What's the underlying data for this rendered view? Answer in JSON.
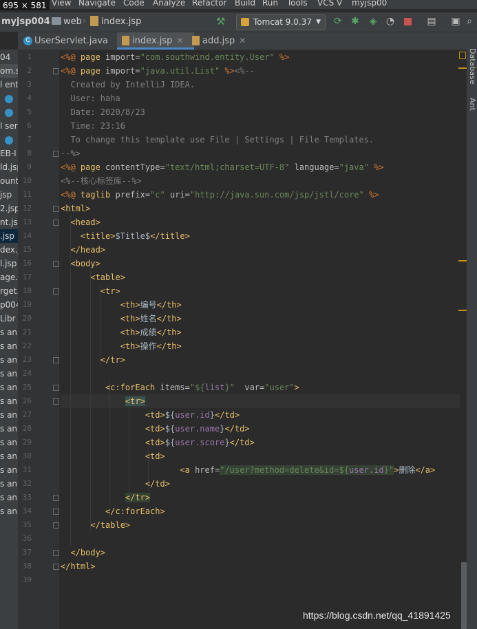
{
  "dimensions_badge": "695 × 581",
  "menu": [
    "t",
    "View",
    "Navigate",
    "Code",
    "Analyze",
    "Refactor",
    "Build",
    "Run",
    "Tools",
    "VCS",
    "V",
    "myjsp00"
  ],
  "breadcrumb": {
    "project": "myjsp004",
    "folder": "web",
    "file": "index.jsp"
  },
  "run_config": "Tomcat 9.0.37",
  "tabs": [
    {
      "label": "UserServlet.java",
      "type": "java"
    },
    {
      "label": "index.jsp",
      "type": "jsp",
      "active": true
    },
    {
      "label": "add.jsp",
      "type": "jsp"
    }
  ],
  "right_tools": [
    "Database",
    "Ant"
  ],
  "left_panel": [
    "04",
    "om.sc",
    "l ent",
    "",
    "",
    "l ser",
    "",
    "EB-I",
    "ld.jsp",
    "ount.j",
    "jsp",
    "2.jsp",
    "nt.jsp",
    ".jsp",
    "dex.js",
    "l.jsp",
    "age.j",
    "rget.",
    "p004",
    "Libr",
    "s an",
    "s an",
    "s an",
    "s an",
    "s an",
    "s an",
    "s an",
    "s an",
    "s an",
    "s an",
    "s an",
    "s an",
    "s an",
    "s an"
  ],
  "code_lines": [
    [
      [
        "dir",
        "<%@ "
      ],
      [
        "tag",
        "page"
      ],
      [
        "attr",
        " import="
      ],
      [
        "str",
        "\"com.southwind.entity.User\""
      ],
      [
        "dir",
        " %>"
      ]
    ],
    [
      [
        "dir",
        "<%@ "
      ],
      [
        "tag",
        "page"
      ],
      [
        "attr",
        " import="
      ],
      [
        "str",
        "\"java.util.List\""
      ],
      [
        "dir",
        " %>"
      ],
      [
        "cmt",
        "<%--"
      ]
    ],
    [
      [
        "cmt",
        "  Created by IntelliJ IDEA."
      ]
    ],
    [
      [
        "cmt",
        "  User: haha"
      ]
    ],
    [
      [
        "cmt",
        "  Date: 2020/8/23"
      ]
    ],
    [
      [
        "cmt",
        "  Time: 23:16"
      ]
    ],
    [
      [
        "cmt",
        "  To change this template use File | Settings | File Templates."
      ]
    ],
    [
      [
        "cmt",
        "--%>"
      ]
    ],
    [
      [
        "dir",
        "<%@ "
      ],
      [
        "tag",
        "page"
      ],
      [
        "attr",
        " contentType="
      ],
      [
        "str",
        "\"text/html;charset=UTF-8\""
      ],
      [
        "attr",
        " language="
      ],
      [
        "str",
        "\"java\""
      ],
      [
        "dir",
        " %>"
      ]
    ],
    [
      [
        "cmt",
        "<%--核心标签库--%>"
      ]
    ],
    [
      [
        "dir",
        "<%@ "
      ],
      [
        "tag",
        "taglib"
      ],
      [
        "attr",
        " prefix="
      ],
      [
        "str",
        "\"c\""
      ],
      [
        "attr",
        " uri="
      ],
      [
        "str",
        "\"http://java.sun.com/jsp/jstl/core\""
      ],
      [
        "dir",
        " %>"
      ]
    ],
    [
      [
        "tag",
        "<html>"
      ]
    ],
    [
      [
        "txt",
        "  "
      ],
      [
        "tag",
        "<head>"
      ]
    ],
    [
      [
        "txt",
        "    "
      ],
      [
        "tag",
        "<title>"
      ],
      [
        "txt",
        "$Title$"
      ],
      [
        "tag",
        "</title>"
      ]
    ],
    [
      [
        "txt",
        "  "
      ],
      [
        "tag",
        "</head>"
      ]
    ],
    [
      [
        "txt",
        "  "
      ],
      [
        "tag",
        "<body>"
      ]
    ],
    [
      [
        "txt",
        "      "
      ],
      [
        "tag",
        "<table>"
      ]
    ],
    [
      [
        "txt",
        "        "
      ],
      [
        "tag",
        "<tr>"
      ]
    ],
    [
      [
        "txt",
        "            "
      ],
      [
        "tag",
        "<th>"
      ],
      [
        "txt",
        "编号"
      ],
      [
        "tag",
        "</th>"
      ]
    ],
    [
      [
        "txt",
        "            "
      ],
      [
        "tag",
        "<th>"
      ],
      [
        "txt",
        "姓名"
      ],
      [
        "tag",
        "</th>"
      ]
    ],
    [
      [
        "txt",
        "            "
      ],
      [
        "tag",
        "<th>"
      ],
      [
        "txt",
        "成绩"
      ],
      [
        "tag",
        "</th>"
      ]
    ],
    [
      [
        "txt",
        "            "
      ],
      [
        "tag",
        "<th>"
      ],
      [
        "txt",
        "操作"
      ],
      [
        "tag",
        "</th>"
      ]
    ],
    [
      [
        "txt",
        "        "
      ],
      [
        "tag",
        "</tr>"
      ]
    ],
    [],
    [
      [
        "txt",
        "         "
      ],
      [
        "tag",
        "<c:forEach"
      ],
      [
        "attr",
        " items="
      ],
      [
        "str",
        "\"${"
      ],
      [
        "el",
        "list"
      ],
      [
        "str",
        "}\""
      ],
      [
        "attr",
        "  var="
      ],
      [
        "str",
        "\"user\""
      ],
      [
        "tag",
        ">"
      ]
    ],
    [
      [
        "txt",
        "             "
      ],
      [
        "hl",
        "<tr>"
      ]
    ],
    [
      [
        "txt",
        "                 "
      ],
      [
        "tag",
        "<td>"
      ],
      [
        "txt",
        "${"
      ],
      [
        "el",
        "user.id"
      ],
      [
        "txt",
        "}"
      ],
      [
        "tag",
        "</td>"
      ]
    ],
    [
      [
        "txt",
        "                 "
      ],
      [
        "tag",
        "<td>"
      ],
      [
        "txt",
        "${"
      ],
      [
        "el",
        "user.name"
      ],
      [
        "txt",
        "}"
      ],
      [
        "tag",
        "</td>"
      ]
    ],
    [
      [
        "txt",
        "                 "
      ],
      [
        "tag",
        "<td>"
      ],
      [
        "txt",
        "${"
      ],
      [
        "el",
        "user.score"
      ],
      [
        "txt",
        "}"
      ],
      [
        "tag",
        "</td>"
      ]
    ],
    [
      [
        "txt",
        "                 "
      ],
      [
        "tag",
        "<td>"
      ]
    ],
    [
      [
        "txt",
        "                        "
      ],
      [
        "tag",
        "<a"
      ],
      [
        "attr",
        " href="
      ],
      [
        "str2",
        "\"/user?method=delete&id=${"
      ],
      [
        "el2",
        "user.id"
      ],
      [
        "str2",
        "}\""
      ],
      [
        "tag",
        ">"
      ],
      [
        "txt",
        "删除"
      ],
      [
        "tag",
        "</a>"
      ]
    ],
    [
      [
        "txt",
        "                 "
      ],
      [
        "tag",
        "</td>"
      ]
    ],
    [
      [
        "txt",
        "             "
      ],
      [
        "hl2",
        "</tr>"
      ]
    ],
    [
      [
        "txt",
        "         "
      ],
      [
        "tag",
        "</c:forEach>"
      ]
    ],
    [
      [
        "txt",
        "      "
      ],
      [
        "tag",
        "</table>"
      ]
    ],
    [],
    [
      [
        "txt",
        "  "
      ],
      [
        "tag",
        "</body>"
      ]
    ],
    [
      [
        "tag",
        "</html>"
      ]
    ],
    []
  ],
  "watermark": "https://blog.csdn.net/qq_41891425"
}
